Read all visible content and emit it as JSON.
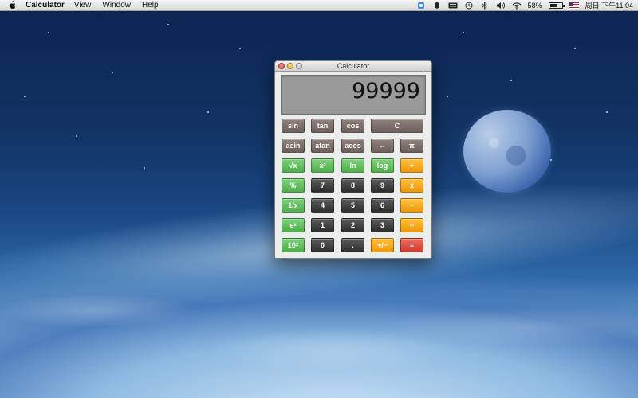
{
  "menubar": {
    "app_name": "Calculator",
    "menus": [
      "View",
      "Window",
      "Help"
    ],
    "battery_percent": "58%",
    "battery_level": 0.58,
    "clock": "周日 下午11:04",
    "icons": [
      "apple-icon",
      "qq-icon",
      "ghost-icon",
      "keyboard-icon",
      "time-machine-icon",
      "bluetooth-icon",
      "volume-icon",
      "wifi-icon",
      "battery-icon",
      "input-source-flag-icon"
    ]
  },
  "window": {
    "title": "Calculator",
    "display_value": "99999"
  },
  "keys": {
    "sin": "sin",
    "tan": "tan",
    "cos": "cos",
    "clear": "C",
    "asin": "asin",
    "atan": "atan",
    "acos": "acos",
    "back": "←",
    "pi": "π",
    "sqrt": "√x",
    "square": "x²",
    "ln": "ln",
    "log": "log",
    "divide": "÷",
    "percent": "%",
    "k7": "7",
    "k8": "8",
    "k9": "9",
    "multiply": "x",
    "reciprocal": "1/x",
    "k4": "4",
    "k5": "5",
    "k6": "6",
    "minus": "−",
    "exp": "eˣ",
    "k1": "1",
    "k2": "2",
    "k3": "3",
    "plus": "+",
    "pow10": "10ˣ",
    "k0": "0",
    "dot": ".",
    "negate": "+/−",
    "equals": "="
  },
  "colors": {
    "function_key": "#7c6e68",
    "green_key": "#5fbe5a",
    "digit_key": "#444444",
    "operator_key": "#f7a91d",
    "equals_key": "#dd4f44",
    "display_bg": "#9a9a9a"
  }
}
